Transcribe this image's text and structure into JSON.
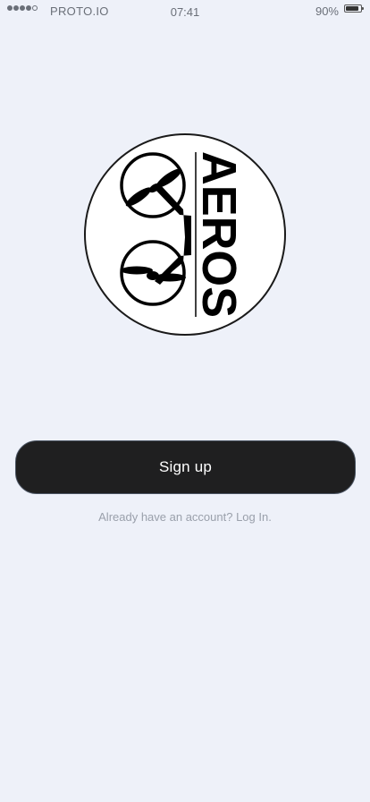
{
  "status_bar": {
    "carrier": "PROTO.IO",
    "time": "07:41",
    "battery_percent": "90%",
    "battery_level": 0.9,
    "signal_strength": 4,
    "signal_max": 5
  },
  "logo": {
    "text": "AEROS",
    "icon": "drone-logo-icon"
  },
  "signup_button": {
    "label": "Sign up"
  },
  "login_prompt": {
    "text": "Already have an account? Log In."
  },
  "colors": {
    "background": "#eef1f9",
    "button": "#1f1f20",
    "button_text": "#ffffff",
    "muted_text": "#9aa0ab"
  }
}
